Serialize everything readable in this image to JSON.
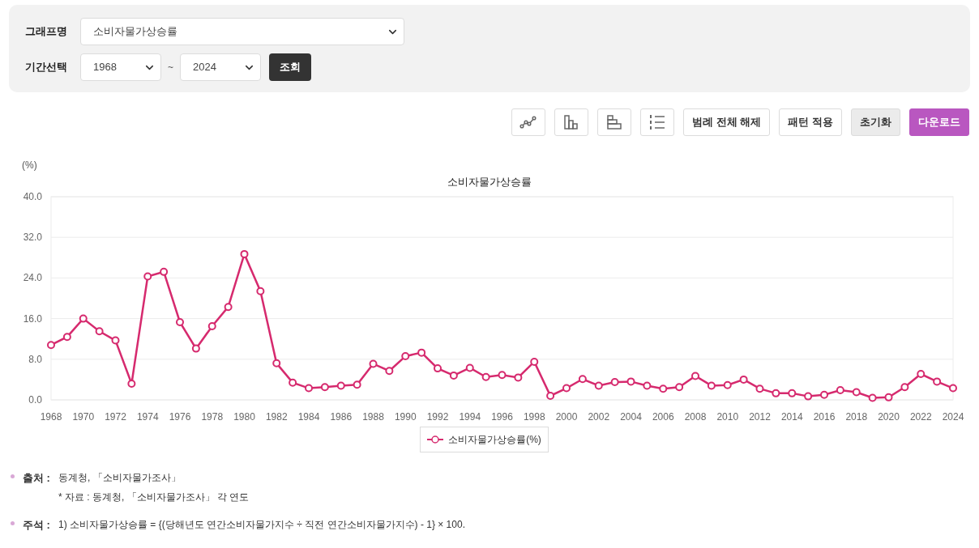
{
  "filters": {
    "graph": {
      "label": "그래프명",
      "value": "소비자물가상승률"
    },
    "period": {
      "label": "기간선택",
      "start": "1968",
      "separator": "~",
      "end": "2024"
    },
    "search_button": "조회"
  },
  "toolbar": [
    {
      "kind": "line-chart"
    },
    {
      "kind": "bar-chart"
    },
    {
      "kind": "horizontal-bar-chart"
    },
    {
      "kind": "numbered-list"
    },
    {
      "kind": "outline",
      "label": "범례 전체 해제"
    },
    {
      "kind": "outline",
      "label": "패턴 적용"
    },
    {
      "kind": "gray",
      "label": "초기화"
    },
    {
      "kind": "primary",
      "label": "다운로드"
    }
  ],
  "chart": {
    "chart_data": {
      "type": "line",
      "title": "소비자물가상승률",
      "ylabel": "(%)",
      "grid": true,
      "x": [
        1968,
        1969,
        1970,
        1971,
        1972,
        1973,
        1974,
        1975,
        1976,
        1977,
        1978,
        1979,
        1980,
        1981,
        1982,
        1983,
        1984,
        1985,
        1986,
        1987,
        1988,
        1989,
        1990,
        1991,
        1992,
        1993,
        1994,
        1995,
        1996,
        1997,
        1998,
        1999,
        2000,
        2001,
        2002,
        2003,
        2004,
        2005,
        2006,
        2007,
        2008,
        2009,
        2010,
        2011,
        2012,
        2013,
        2014,
        2015,
        2016,
        2017,
        2018,
        2019,
        2020,
        2021,
        2022,
        2023,
        2024
      ],
      "series": [
        {
          "name": "소비자물가상승률(%)",
          "color": "#d62a6e",
          "marker": "circle",
          "values": [
            10.8,
            12.4,
            16.0,
            13.5,
            11.7,
            3.2,
            24.3,
            25.2,
            15.3,
            10.1,
            14.5,
            18.3,
            28.7,
            21.4,
            7.2,
            3.4,
            2.3,
            2.5,
            2.8,
            3.0,
            7.1,
            5.7,
            8.6,
            9.3,
            6.2,
            4.8,
            6.3,
            4.5,
            4.9,
            4.4,
            7.5,
            0.8,
            2.3,
            4.1,
            2.8,
            3.5,
            3.6,
            2.8,
            2.2,
            2.5,
            4.7,
            2.8,
            2.9,
            4.0,
            2.2,
            1.3,
            1.3,
            0.7,
            1.0,
            1.9,
            1.5,
            0.4,
            0.5,
            2.5,
            5.1,
            3.6,
            2.3
          ]
        }
      ],
      "xlim": [
        1968,
        2024
      ],
      "ylim": [
        0,
        40
      ],
      "xticks": [
        1968,
        1970,
        1972,
        1974,
        1976,
        1978,
        1980,
        1982,
        1984,
        1986,
        1988,
        1990,
        1992,
        1994,
        1996,
        1998,
        2000,
        2002,
        2004,
        2006,
        2008,
        2010,
        2012,
        2014,
        2016,
        2018,
        2020,
        2022,
        2024
      ],
      "yticks": [
        {
          "value": 0,
          "label": "0.0"
        },
        {
          "value": 8,
          "label": "8.0"
        },
        {
          "value": 16,
          "label": "16.0"
        },
        {
          "value": 24,
          "label": "24.0"
        },
        {
          "value": 32,
          "label": "32.0"
        },
        {
          "value": 40,
          "label": "40.0"
        }
      ]
    }
  },
  "notes": [
    {
      "label": "출처 :",
      "lines": [
        "동계청, 「소비자물가조사」",
        "* 자료 : 동계청, 「소비자물가조사」 각 연도"
      ]
    },
    {
      "label": "주석 :",
      "lines": [
        "1) 소비자물가상승률 = {(당해년도 연간소비자물가지수 ÷ 직전 연간소비자물가지수) - 1} × 100."
      ]
    }
  ]
}
